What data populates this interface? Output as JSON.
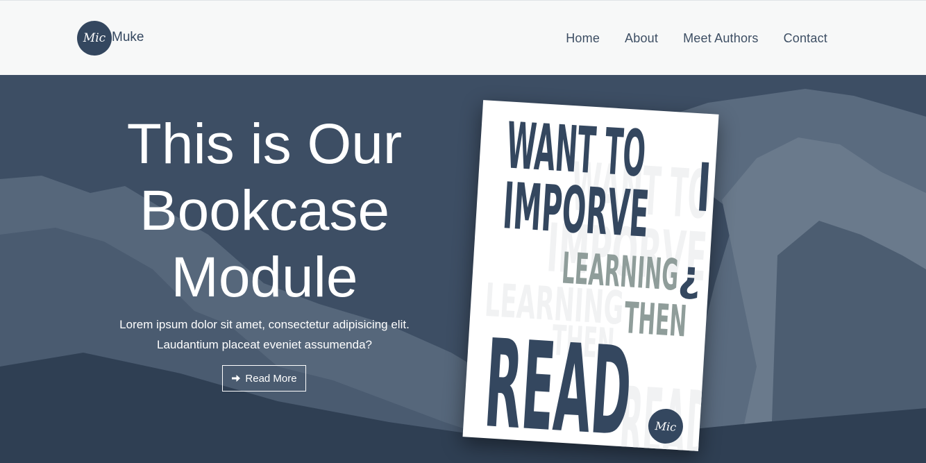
{
  "brand": {
    "logo_text": "Mic",
    "name": "Muke"
  },
  "nav": {
    "items": [
      "Home",
      "About",
      "Meet Authors",
      "Contact"
    ]
  },
  "hero": {
    "title_lines": [
      "This is Our",
      "Bookcase",
      "Module"
    ],
    "desc_lines": [
      "Lorem ipsum dolor sit amet, consectetur adipisicing elit.",
      "Laudantium placeat eveniet assumenda?"
    ],
    "button_label": "Read More",
    "button_icon": "arrow-right-icon"
  },
  "book": {
    "line1": "WANT TO",
    "line2": "IMPORVE",
    "line3": "LEARNING",
    "question_mark": "¿",
    "line4": "THEN",
    "line5": "READ",
    "logo_text": "Mic"
  },
  "colors": {
    "brand_navy": "#34475f",
    "nav_background": "#f7f8f8",
    "hero_overlay": "#3c4d63",
    "book_gray_text": "#8f9d9a"
  }
}
